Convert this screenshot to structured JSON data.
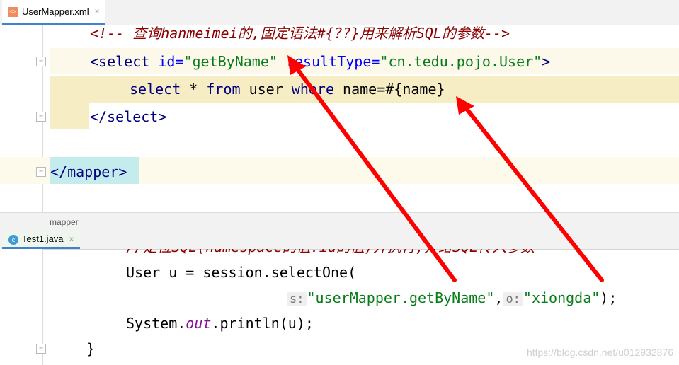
{
  "xml_tab": {
    "label": "UserMapper.xml",
    "close": "×",
    "icon": "xml-file-icon"
  },
  "xml_code": {
    "comment": "<!-- 查询hanmeimei的,固定语法#{??}用来解析SQL的参数-->",
    "select_open_1": "<select ",
    "id_attr": "id=",
    "id_val": "\"getByName\"",
    "rt_attr": " resultType=",
    "rt_val": "\"cn.tedu.pojo.User\"",
    "gt": ">",
    "sql_kw1": "select",
    "sql_mid": " * ",
    "sql_kw2": "from",
    "sql_tbl": " user ",
    "sql_kw3": "where",
    "sql_rest": " name=#{name}",
    "select_close": "</select>",
    "mapper_close": "</mapper>"
  },
  "breadcrumb": {
    "item": "mapper"
  },
  "java_tab": {
    "label": "Test1.java",
    "close": "×",
    "icon": "java-class-icon"
  },
  "java_code": {
    "comment": "//定位SQL(namespace的值.id的值)并执行,并给SQL传入参数",
    "line1": "User u = session.selectOne(",
    "hint_s": "s:",
    "arg1": "\"userMapper.getByName\"",
    "comma": ",",
    "hint_o": "o:",
    "arg2": "\"xiongda\"",
    "end": ");",
    "sys": "System.",
    "out": "out",
    "println": ".println(u);",
    "brace": "}"
  },
  "watermark": "https://blog.csdn.net/u012932876",
  "colors": {
    "arrow": "#ff0000",
    "highlight": "#f7edc5",
    "accent": "#4083c9"
  }
}
